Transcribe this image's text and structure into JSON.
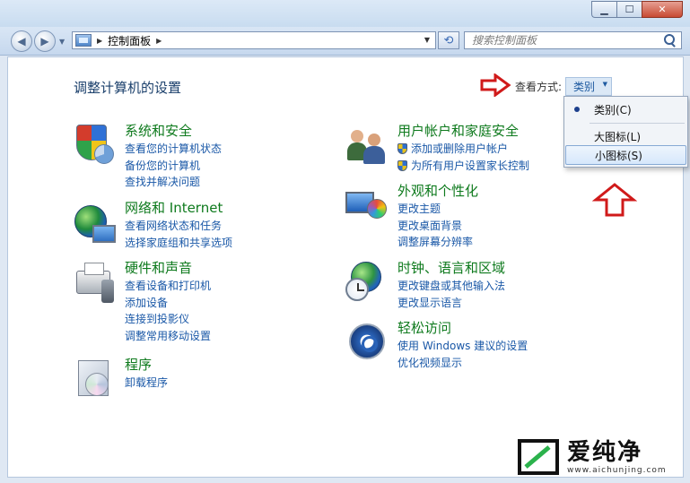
{
  "window": {
    "minimize": "▁",
    "maximize": "☐",
    "close": "✕"
  },
  "nav": {
    "back": "◀",
    "forward": "▶",
    "breadcrumb": "控制面板",
    "refresh": "⟲"
  },
  "search": {
    "placeholder": "搜索控制面板"
  },
  "page": {
    "title": "调整计算机的设置",
    "view_by_label": "查看方式:",
    "view_by_value": "类别"
  },
  "categories": [
    {
      "title": "系统和安全",
      "links": [
        "查看您的计算机状态",
        "备份您的计算机",
        "查找并解决问题"
      ]
    },
    {
      "title": "网络和 Internet",
      "links": [
        "查看网络状态和任务",
        "选择家庭组和共享选项"
      ]
    },
    {
      "title": "硬件和声音",
      "links": [
        "查看设备和打印机",
        "添加设备",
        "连接到投影仪",
        "调整常用移动设置"
      ]
    },
    {
      "title": "程序",
      "links": [
        "卸载程序"
      ]
    },
    {
      "title": "用户帐户和家庭安全",
      "links": [
        "添加或删除用户帐户",
        "为所有用户设置家长控制"
      ]
    },
    {
      "title": "外观和个性化",
      "links": [
        "更改主题",
        "更改桌面背景",
        "调整屏幕分辨率"
      ]
    },
    {
      "title": "时钟、语言和区域",
      "links": [
        "更改键盘或其他输入法",
        "更改显示语言"
      ]
    },
    {
      "title": "轻松访问",
      "links": [
        "使用 Windows 建议的设置",
        "优化视频显示"
      ]
    }
  ],
  "dropdown": {
    "items": [
      "类别(C)",
      "大图标(L)",
      "小图标(S)"
    ],
    "selected": "类别(C)",
    "highlighted": "小图标(S)"
  },
  "watermark": {
    "name": "爱纯净",
    "url": "www.aichunjing.com"
  },
  "colors": {
    "category_title": "#0e7a1d",
    "link": "#1a58a7",
    "annotation_arrow": "#d01a1a"
  }
}
